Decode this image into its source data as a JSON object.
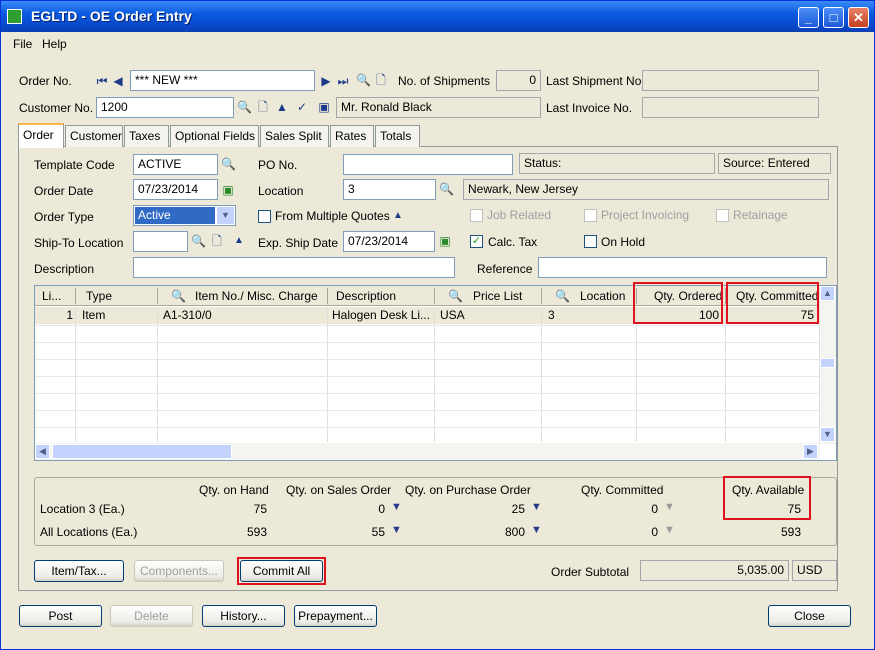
{
  "window": {
    "title": "EGLTD - OE Order Entry",
    "min": "_",
    "max": "□",
    "close": "✕"
  },
  "menu": [
    "File",
    "Help"
  ],
  "header": {
    "order_no_label": "Order No.",
    "order_no": "*** NEW ***",
    "shipments_label": "No. of Shipments",
    "shipments": "0",
    "last_shipment_label": "Last Shipment No.",
    "last_shipment": "",
    "customer_no_label": "Customer No.",
    "customer_no": "1200",
    "customer_name": "Mr. Ronald Black",
    "last_invoice_label": "Last Invoice No.",
    "last_invoice": ""
  },
  "tabs": [
    "Order",
    "Customer",
    "Taxes",
    "Optional Fields",
    "Sales Split",
    "Rates",
    "Totals"
  ],
  "order": {
    "template_code_label": "Template Code",
    "template_code": "ACTIVE",
    "po_label": "PO No.",
    "po": "",
    "status": "Status:",
    "source": "Source: Entered",
    "order_date_label": "Order Date",
    "order_date": "07/23/2014",
    "location_label": "Location",
    "location": "3",
    "location_desc": "Newark, New Jersey",
    "order_type_label": "Order Type",
    "order_type": "Active",
    "multi_quotes": "From Multiple Quotes",
    "job_related": "Job Related",
    "project_invoicing": "Project Invoicing",
    "retainage": "Retainage",
    "ship_to_label": "Ship-To Location",
    "ship_to": "",
    "exp_ship_label": "Exp. Ship Date",
    "exp_ship": "07/23/2014",
    "calc_tax": "Calc. Tax",
    "on_hold": "On Hold",
    "description_label": "Description",
    "description": "",
    "reference_label": "Reference",
    "reference": ""
  },
  "grid": {
    "headers": [
      "Li...",
      "Type",
      "Item No./ Misc. Charge",
      "Description",
      "Price List",
      "Location",
      "Qty. Ordered",
      "Qty. Committed"
    ],
    "rows": [
      {
        "line": "1",
        "type": "Item",
        "item": "A1-310/0",
        "desc": "Halogen Desk Li...",
        "price_list": "USA",
        "location": "3",
        "ordered": "100",
        "committed": "75"
      }
    ]
  },
  "qty": {
    "headers": [
      "Qty. on Hand",
      "Qty. on Sales Order",
      "Qty. on Purchase Order",
      "Qty. Committed",
      "Qty. Available"
    ],
    "loc_label": "Location  3 (Ea.)",
    "all_label": "All Locations (Ea.)",
    "loc": [
      "75",
      "0",
      "25",
      "0",
      "75"
    ],
    "all": [
      "593",
      "55",
      "800",
      "0",
      "593"
    ]
  },
  "buttons": {
    "item_tax": "Item/Tax...",
    "components": "Components...",
    "commit_all": "Commit All",
    "post": "Post",
    "delete": "Delete",
    "history": "History...",
    "prepayment": "Prepayment...",
    "close": "Close"
  },
  "subtotal": {
    "label": "Order Subtotal",
    "value": "5,035.00",
    "currency": "USD"
  }
}
